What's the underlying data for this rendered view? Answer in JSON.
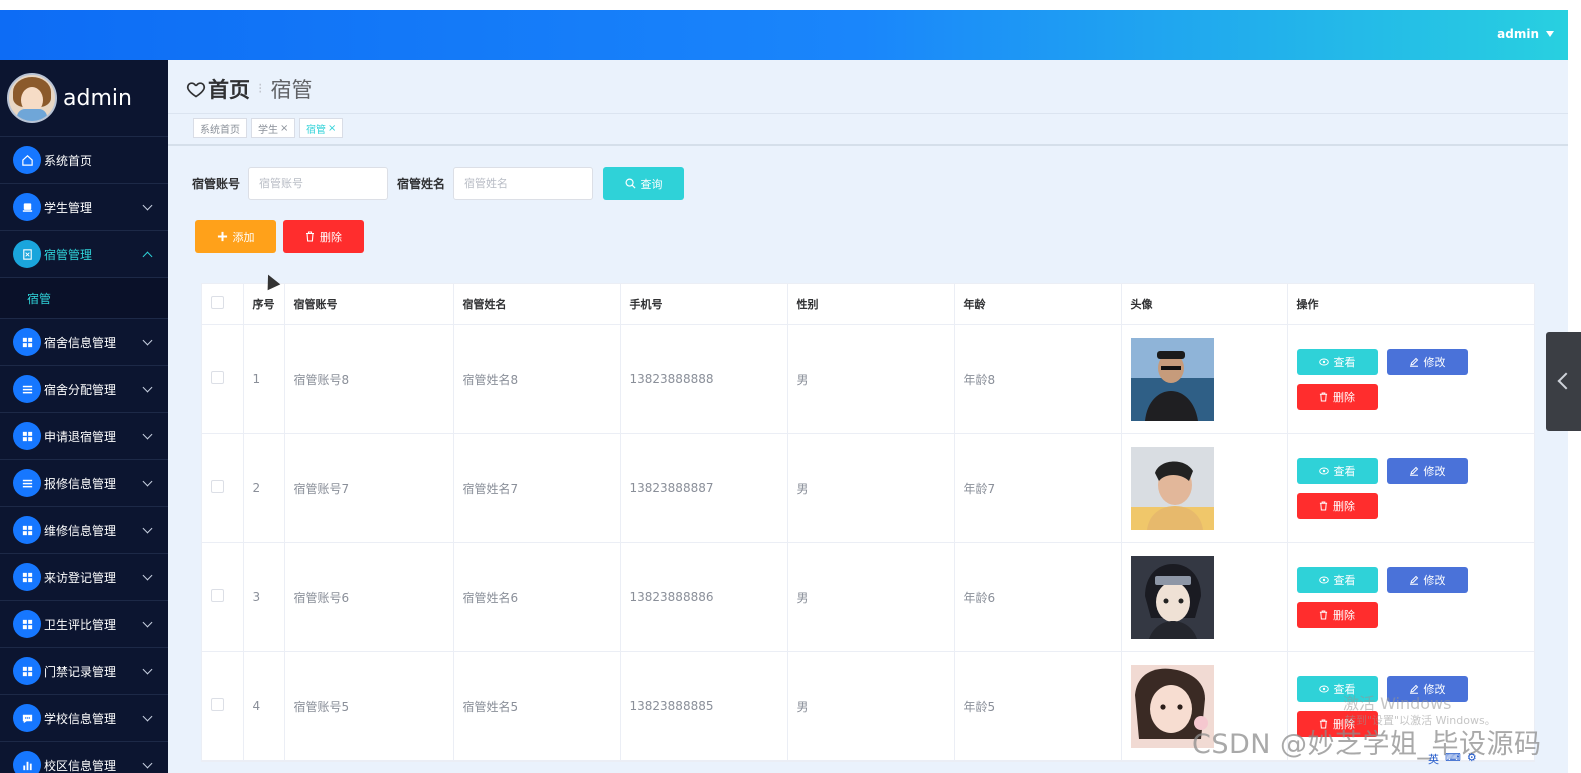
{
  "header": {
    "user": "admin"
  },
  "sidebar": {
    "brand": "admin",
    "items": [
      {
        "label": "系统首页",
        "icon": "home-icon",
        "has_arrow": false
      },
      {
        "label": "学生管理",
        "icon": "user-group-icon",
        "has_arrow": true
      },
      {
        "label": "宿管管理",
        "icon": "document-icon",
        "has_arrow": true,
        "expanded": true,
        "children": [
          "宿管"
        ]
      },
      {
        "label": "宿舍信息管理",
        "icon": "grid-icon",
        "has_arrow": true
      },
      {
        "label": "宿舍分配管理",
        "icon": "list-icon",
        "has_arrow": true
      },
      {
        "label": "申请退宿管理",
        "icon": "grid-icon",
        "has_arrow": true
      },
      {
        "label": "报修信息管理",
        "icon": "list-icon",
        "has_arrow": true
      },
      {
        "label": "维修信息管理",
        "icon": "grid-icon",
        "has_arrow": true
      },
      {
        "label": "来访登记管理",
        "icon": "grid-icon",
        "has_arrow": true
      },
      {
        "label": "卫生评比管理",
        "icon": "grid-icon",
        "has_arrow": true
      },
      {
        "label": "门禁记录管理",
        "icon": "grid-icon",
        "has_arrow": true
      },
      {
        "label": "学校信息管理",
        "icon": "chat-icon",
        "has_arrow": true
      },
      {
        "label": "校区信息管理",
        "icon": "bar-chart-icon",
        "has_arrow": true
      }
    ]
  },
  "breadcrumb": {
    "home": "首页",
    "current": "宿管"
  },
  "tabs": [
    {
      "label": "系统首页",
      "closable": false
    },
    {
      "label": "学生",
      "closable": true
    },
    {
      "label": "宿管",
      "closable": true,
      "active": true
    }
  ],
  "search": {
    "account_label": "宿管账号",
    "account_placeholder": "宿管账号",
    "name_label": "宿管姓名",
    "name_placeholder": "宿管姓名",
    "query_button": "查询"
  },
  "toolbar": {
    "add_label": "添加",
    "delete_label": "删除"
  },
  "table": {
    "columns": [
      "",
      "序号",
      "宿管账号",
      "宿管姓名",
      "手机号",
      "性别",
      "年龄",
      "头像",
      "操作"
    ],
    "rows": [
      {
        "index": "1",
        "account": "宿管账号8",
        "name": "宿管姓名8",
        "phone": "13823888888",
        "gender": "男",
        "age": "年龄8"
      },
      {
        "index": "2",
        "account": "宿管账号7",
        "name": "宿管姓名7",
        "phone": "13823888887",
        "gender": "男",
        "age": "年龄7"
      },
      {
        "index": "3",
        "account": "宿管账号6",
        "name": "宿管姓名6",
        "phone": "13823888886",
        "gender": "男",
        "age": "年龄6"
      },
      {
        "index": "4",
        "account": "宿管账号5",
        "name": "宿管姓名5",
        "phone": "13823888885",
        "gender": "男",
        "age": "年龄5"
      }
    ],
    "actions": {
      "view": "查看",
      "edit": "修改",
      "delete": "删除"
    }
  },
  "overlay": {
    "windows_activate": "激活 Windows",
    "windows_activate_hint": "转到\"设置\"以激活 Windows。",
    "csdn_watermark": "CSDN @妙芝学姐_毕设源码",
    "tray_ime": "英"
  },
  "colors": {
    "header_start": "#0d6cf5",
    "header_end": "#28d0e0",
    "sidebar_bg": "#0c1530",
    "accent": "#2fd2d8",
    "add": "#ffa11a",
    "danger": "#ff2d2d",
    "edit": "#4a72d9"
  }
}
